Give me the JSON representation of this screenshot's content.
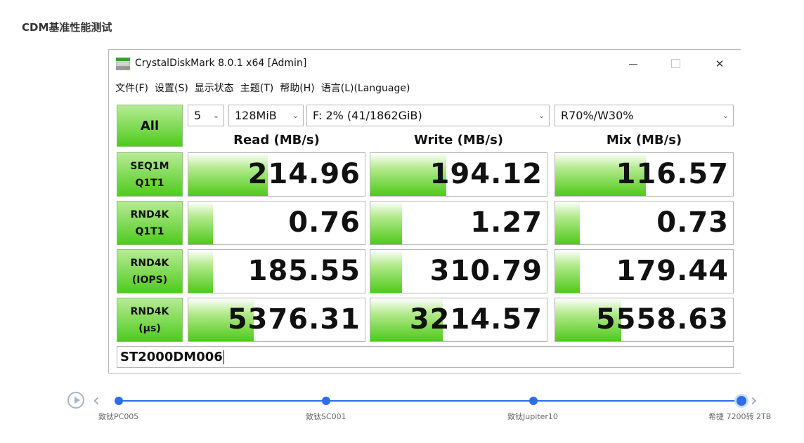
{
  "page": {
    "section_title": "CDM基准性能测试"
  },
  "window": {
    "title": "CrystalDiskMark 8.0.1 x64 [Admin]",
    "controls": {
      "minimize": "—",
      "close": "✕"
    }
  },
  "menu": [
    "文件(F)",
    "设置(S)",
    "显示状态",
    "主题(T)",
    "帮助(H)",
    "语言(L)(Language)"
  ],
  "toolbar": {
    "all_label": "All",
    "count": "5",
    "size": "128MiB",
    "drive": "F: 2% (41/1862GiB)",
    "mix_ratio": "R70%/W30%",
    "chevron": "⌄"
  },
  "columns": {
    "read": "Read (MB/s)",
    "write": "Write (MB/s)",
    "mix": "Mix (MB/s)"
  },
  "rows": [
    {
      "label1": "SEQ1M",
      "label2": "Q1T1",
      "read": "214.96",
      "write": "194.12",
      "mix": "116.57",
      "fill": {
        "read": 0.45,
        "write": 0.43,
        "mix": 0.51
      }
    },
    {
      "label1": "RND4K",
      "label2": "Q1T1",
      "read": "0.76",
      "write": "1.27",
      "mix": "0.73",
      "fill": {
        "read": 0.14,
        "write": 0.18,
        "mix": 0.14
      }
    },
    {
      "label1": "RND4K",
      "label2": "(IOPS)",
      "read": "185.55",
      "write": "310.79",
      "mix": "179.44",
      "fill": {
        "read": 0.14,
        "write": 0.18,
        "mix": 0.14
      }
    },
    {
      "label1": "RND4K",
      "label2": "(μs)",
      "read": "5376.31",
      "write": "3214.57",
      "mix": "5558.63",
      "fill": {
        "read": 0.37,
        "write": 0.41,
        "mix": 0.37
      }
    }
  ],
  "comment": "ST2000DM006",
  "timeline": {
    "items": [
      "致钛PC005",
      "致钛SC001",
      "致钛Jupiter10",
      "希捷 7200转 2TB"
    ],
    "current_index": 3,
    "prev": "‹",
    "next": "›"
  }
}
